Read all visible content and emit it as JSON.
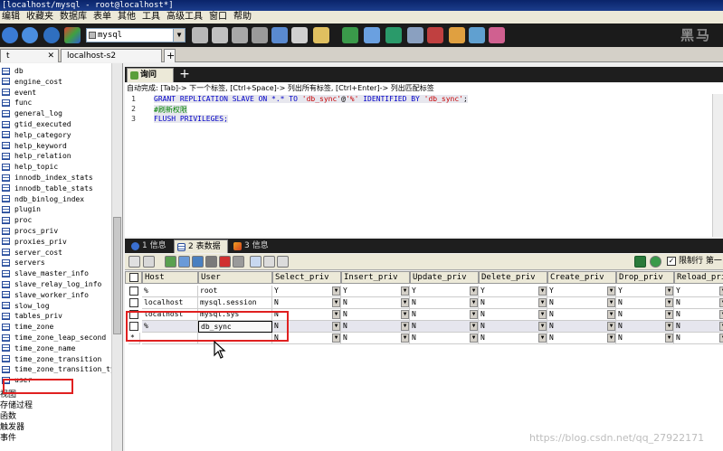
{
  "window": {
    "title": "[localhost/mysql - root@localhost*]"
  },
  "menu": [
    "编辑",
    "收藏夹",
    "数据库",
    "表单",
    "其他",
    "工具",
    "高级工具",
    "窗口",
    "帮助"
  ],
  "toolbar": {
    "db_select": "mysql",
    "logo_text": "黑马"
  },
  "connection_tabs": [
    {
      "label": "t"
    },
    {
      "label": "localhost-s2"
    }
  ],
  "sidebar": {
    "tables": [
      "db",
      "engine_cost",
      "event",
      "func",
      "general_log",
      "gtid_executed",
      "help_category",
      "help_keyword",
      "help_relation",
      "help_topic",
      "innodb_index_stats",
      "innodb_table_stats",
      "ndb_binlog_index",
      "plugin",
      "proc",
      "procs_priv",
      "proxies_priv",
      "server_cost",
      "servers",
      "slave_master_info",
      "slave_relay_log_info",
      "slave_worker_info",
      "slow_log",
      "tables_priv",
      "time_zone",
      "time_zone_leap_second",
      "time_zone_name",
      "time_zone_transition",
      "time_zone_transition_typ",
      "user"
    ],
    "categories": [
      "视图",
      "存储过程",
      "函数",
      "触发器",
      "事件"
    ]
  },
  "query": {
    "tab_label": "询问",
    "add_tab": "+",
    "autocomplete_hint": "自动完成: [Tab]-> 下一个标签, [Ctrl+Space]-> 列出所有标签, [Ctrl+Enter]-> 列出匹配标签",
    "line_numbers": [
      "1",
      "2",
      "3"
    ],
    "line1": {
      "kw1": "GRANT REPLICATION SLAVE ON *.* TO ",
      "s1": "'db_sync'",
      "at": "@",
      "s2": "'%'",
      "kw2": " IDENTIFIED BY ",
      "s3": "'db_sync'",
      "end": ";"
    },
    "line2": "#刷新权限",
    "line3": "FLUSH PRIVILEGES;"
  },
  "result_tabs": [
    "1 信息",
    "2 表数据",
    "3 信息"
  ],
  "grid_toolbar": {
    "limit_label": "限制行  第一",
    "limit_checked": "✓"
  },
  "grid": {
    "columns": [
      "Host",
      "User",
      "Select_priv",
      "Insert_priv",
      "Update_priv",
      "Delete_priv",
      "Create_priv",
      "Drop_priv",
      "Reload_pri"
    ],
    "rows": [
      [
        "%",
        "root",
        "Y",
        "Y",
        "Y",
        "Y",
        "Y",
        "Y",
        "Y"
      ],
      [
        "localhost",
        "mysql.session",
        "N",
        "N",
        "N",
        "N",
        "N",
        "N",
        "N"
      ],
      [
        "localhost",
        "mysql.sys",
        "N",
        "N",
        "N",
        "N",
        "N",
        "N",
        "N"
      ],
      [
        "%",
        "db_sync",
        "N",
        "N",
        "N",
        "N",
        "N",
        "N",
        "N"
      ],
      [
        "",
        "",
        "N",
        "N",
        "N",
        "N",
        "N",
        "N",
        "N"
      ]
    ],
    "new_row_marker": "*"
  },
  "watermark": "https://blog.csdn.net/qq_27922171"
}
